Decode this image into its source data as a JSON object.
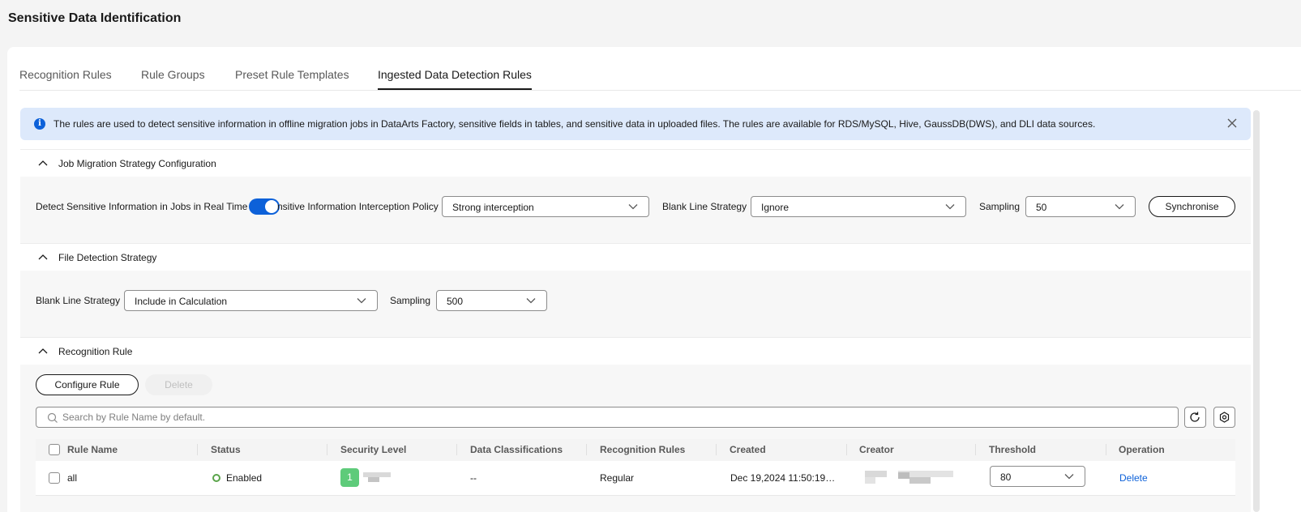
{
  "page": {
    "title": "Sensitive Data Identification"
  },
  "tabs": [
    {
      "label": "Recognition Rules"
    },
    {
      "label": "Rule Groups"
    },
    {
      "label": "Preset Rule Templates"
    },
    {
      "label": "Ingested Data Detection Rules",
      "active": true
    }
  ],
  "alert": {
    "message": "The rules are used to detect sensitive information in offline migration jobs in DataArts Factory, sensitive fields in tables, and sensitive data in uploaded files. The rules are available for RDS/MySQL, Hive, GaussDB(DWS), and DLI data sources."
  },
  "job_migration": {
    "title": "Job Migration Strategy Configuration",
    "detect_realtime_label": "Detect Sensitive Information in Jobs in Real Time",
    "detect_realtime_enabled": true,
    "interception_label": "nsitive Information Interception Policy",
    "interception_value": "Strong interception",
    "blank_line_label": "Blank Line Strategy",
    "blank_line_value": "Ignore",
    "sampling_label": "Sampling",
    "sampling_value": "50",
    "synchronise_label": "Synchronise"
  },
  "file_detection": {
    "title": "File Detection Strategy",
    "blank_line_label": "Blank Line Strategy",
    "blank_line_value": "Include in Calculation",
    "sampling_label": "Sampling",
    "sampling_value": "500"
  },
  "recognition_rule": {
    "title": "Recognition Rule",
    "configure_label": "Configure Rule",
    "delete_label": "Delete",
    "search_placeholder": "Search by Rule Name by default.",
    "columns": [
      "Rule Name",
      "Status",
      "Security Level",
      "Data Classifications",
      "Recognition Rules",
      "Created",
      "Creator",
      "Threshold",
      "Operation"
    ],
    "rows": [
      {
        "rule_name": "all",
        "status": "Enabled",
        "security_level": "1",
        "data_classifications": "--",
        "recognition_rules": "Regular",
        "created": "Dec 19,2024 11:50:19…",
        "threshold": "80",
        "operation": "Delete"
      }
    ]
  },
  "colors": {
    "accent": "#0d61d9",
    "alert_bg": "#dde9fb",
    "enabled_green": "#5aa44a",
    "level_badge": "#5ecb7a"
  },
  "icons": [
    "info-icon",
    "close-icon",
    "chevron-up-icon",
    "chevron-down-icon",
    "search-icon",
    "refresh-icon",
    "settings-icon"
  ]
}
